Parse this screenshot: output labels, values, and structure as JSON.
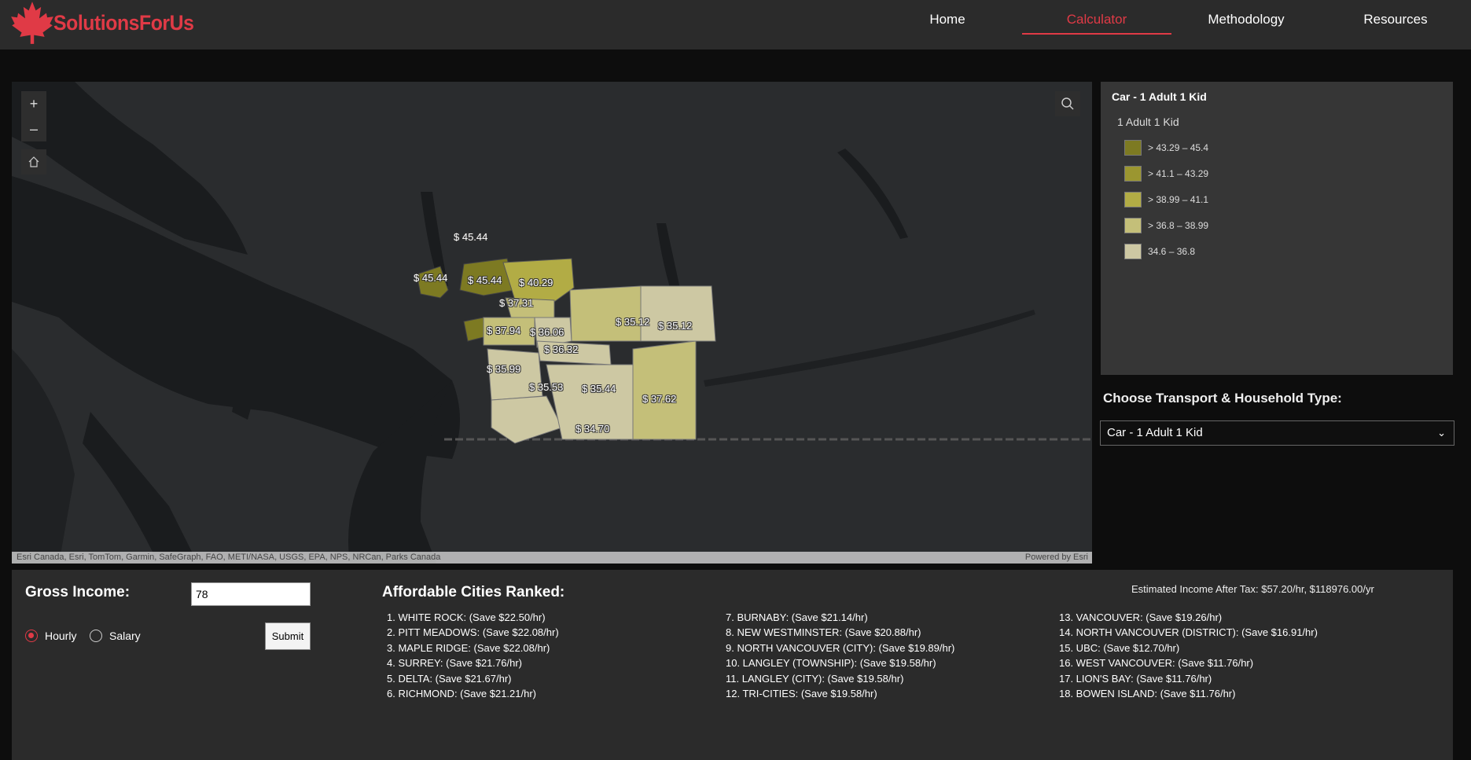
{
  "brand": {
    "name": "SolutionsForUs",
    "color": "#e03a46"
  },
  "nav": {
    "items": [
      {
        "label": "Home"
      },
      {
        "label": "Calculator",
        "active": true
      },
      {
        "label": "Methodology"
      },
      {
        "label": "Resources"
      }
    ]
  },
  "map": {
    "controls": {
      "zoom_in": "+",
      "zoom_out": "–"
    },
    "attribution": "Esri Canada, Esri, TomTom, Garmin, SafeGraph, FAO, METI/NASA, USGS, EPA, NPS, NRCan, Parks Canada",
    "powered_by": "Powered by Esri",
    "labels": [
      "$ 45.44",
      "$ 45.44",
      "$ 45.44",
      "$ 40.29",
      "$ 37.31",
      "$ 37.94",
      "$ 36.06",
      "$ 36.32",
      "$ 35.12",
      "$ 35.12",
      "$ 35.99",
      "$ 35.53",
      "$ 35.44",
      "$ 37.62",
      "$ 34.70"
    ]
  },
  "legend": {
    "title": "Car - 1 Adult 1 Kid",
    "subtitle": "1 Adult 1 Kid",
    "items": [
      {
        "label": "> 43.29 – 45.4",
        "color": "#7d7a22"
      },
      {
        "label": "> 41.1 – 43.29",
        "color": "#9b9630"
      },
      {
        "label": "> 38.99 – 41.1",
        "color": "#b2ac45"
      },
      {
        "label": "> 36.8 – 38.99",
        "color": "#c4bf79"
      },
      {
        "label": "34.6 – 36.8",
        "color": "#cdc8a3"
      }
    ]
  },
  "transport": {
    "label": "Choose Transport & Household Type:",
    "selected": "Car - 1 Adult 1 Kid"
  },
  "income": {
    "label": "Gross Income:",
    "value": "78",
    "options": [
      {
        "label": "Hourly",
        "checked": true
      },
      {
        "label": "Salary",
        "checked": false
      }
    ],
    "submit": "Submit"
  },
  "results": {
    "title": "Affordable Cities Ranked:",
    "estimate": "Estimated Income After Tax: $57.20/hr, $118976.00/yr",
    "ranked": [
      "1. WHITE ROCK: (Save $22.50/hr)",
      "2. PITT MEADOWS: (Save $22.08/hr)",
      "3. MAPLE RIDGE: (Save $22.08/hr)",
      "4. SURREY: (Save $21.76/hr)",
      "5. DELTA: (Save $21.67/hr)",
      "6. RICHMOND: (Save $21.21/hr)",
      "7. BURNABY: (Save $21.14/hr)",
      "8. NEW WESTMINSTER: (Save $20.88/hr)",
      "9. NORTH VANCOUVER (CITY): (Save $19.89/hr)",
      "10. LANGLEY (TOWNSHIP): (Save $19.58/hr)",
      "11. LANGLEY (CITY): (Save $19.58/hr)",
      "12. TRI-CITIES: (Save $19.58/hr)",
      "13. VANCOUVER: (Save $19.26/hr)",
      "14. NORTH VANCOUVER (DISTRICT): (Save $16.91/hr)",
      "15. UBC: (Save $12.70/hr)",
      "16. WEST VANCOUVER: (Save $11.76/hr)",
      "17. LION'S BAY: (Save $11.76/hr)",
      "18. BOWEN ISLAND: (Save $11.76/hr)"
    ]
  }
}
